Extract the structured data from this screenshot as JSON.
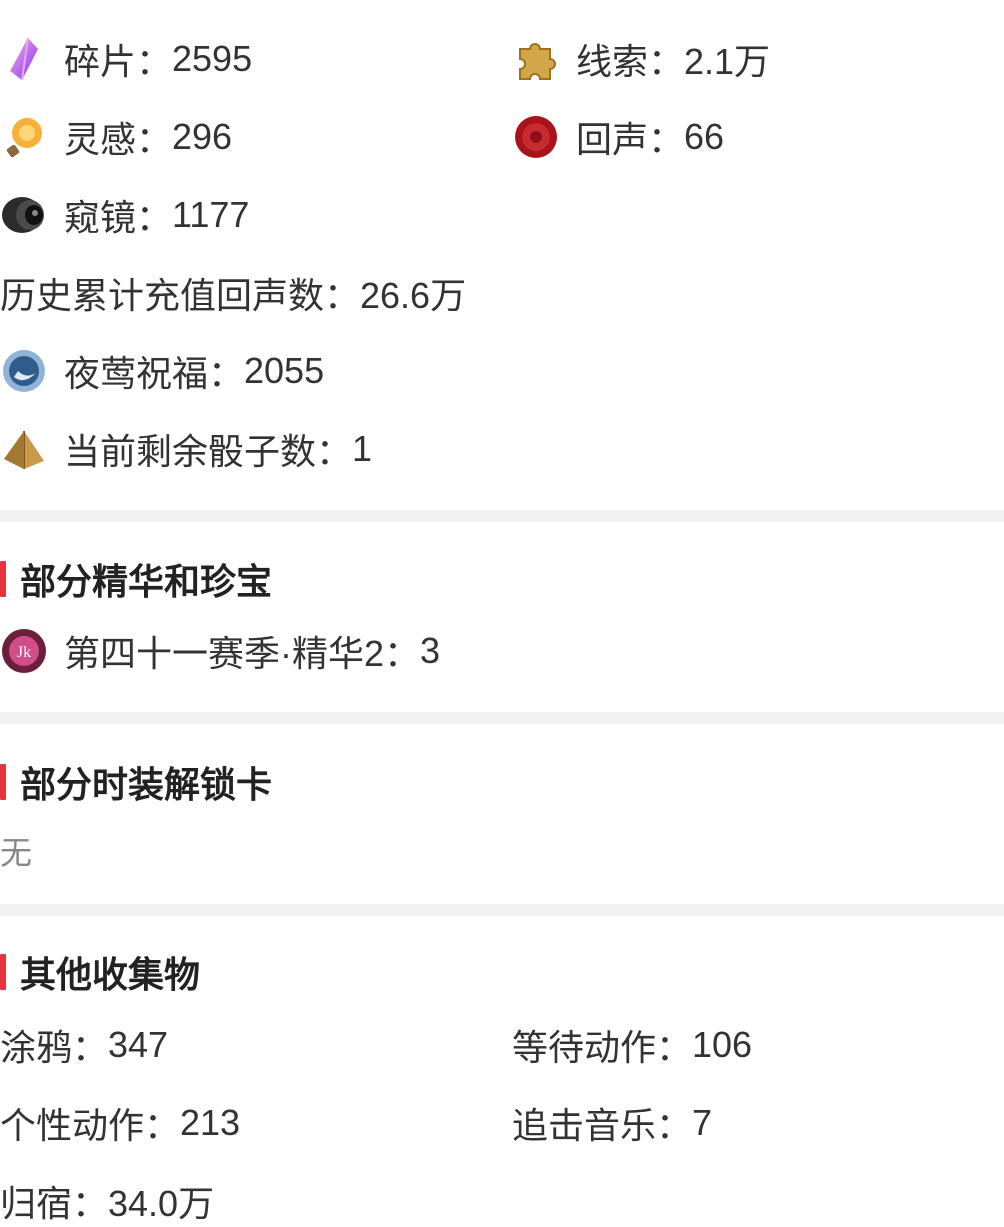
{
  "currency": {
    "items": [
      {
        "label": "碎片：",
        "value": "2595",
        "icon": "crystal-shard-icon"
      },
      {
        "label": "线索：",
        "value": "2.1万",
        "icon": "puzzle-piece-icon"
      },
      {
        "label": "灵感：",
        "value": "296",
        "icon": "lightbulb-icon"
      },
      {
        "label": "回声：",
        "value": "66",
        "icon": "wax-seal-icon"
      },
      {
        "label": "窥镜：",
        "value": "1177",
        "icon": "spyglass-icon"
      }
    ],
    "history_label": "历史累计充值回声数：",
    "history_value": "26.6万",
    "blessing": {
      "label": "夜莺祝福：",
      "value": "2055",
      "icon": "moon-orb-icon"
    },
    "dice": {
      "label": "当前剩余骰子数：",
      "value": "1",
      "icon": "dice-icon"
    }
  },
  "essence": {
    "title": "部分精华和珍宝",
    "item": {
      "label": "第四十一赛季·精华2：",
      "value": "3",
      "icon": "essence-badge-icon"
    }
  },
  "costume": {
    "title": "部分时装解锁卡",
    "empty": "无"
  },
  "collectibles": {
    "title": "其他收集物",
    "items": [
      {
        "label": "涂鸦：",
        "value": "347"
      },
      {
        "label": "等待动作：",
        "value": "106"
      },
      {
        "label": "个性动作：",
        "value": "213"
      },
      {
        "label": "追击音乐：",
        "value": "7"
      },
      {
        "label": "归宿：",
        "value": "34.0万"
      }
    ]
  },
  "colors": {
    "accent": "#e5343d",
    "separator": "#f2f2f2",
    "text": "#333333"
  }
}
